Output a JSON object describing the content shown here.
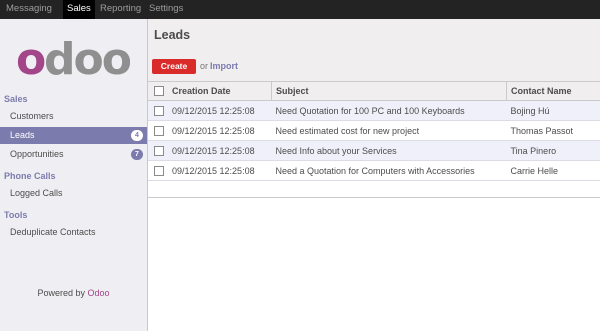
{
  "topnav": {
    "items": [
      {
        "label": "Messaging",
        "active": false
      },
      {
        "label": "Sales",
        "active": true
      },
      {
        "label": "Reporting",
        "active": false
      },
      {
        "label": "Settings",
        "active": false
      }
    ]
  },
  "brand": {
    "logo_text": "odoo",
    "logo_color": "#8f8f8f"
  },
  "sidebar": {
    "sections": [
      {
        "title": "Sales",
        "items": [
          {
            "label": "Customers",
            "badge": null,
            "active": false
          },
          {
            "label": "Leads",
            "badge": "4",
            "active": true
          },
          {
            "label": "Opportunities",
            "badge": "7",
            "active": false
          }
        ]
      },
      {
        "title": "Phone Calls",
        "items": [
          {
            "label": "Logged Calls",
            "badge": null,
            "active": false
          }
        ]
      },
      {
        "title": "Tools",
        "items": [
          {
            "label": "Deduplicate Contacts",
            "badge": null,
            "active": false
          }
        ]
      }
    ],
    "powered_prefix": "Powered by",
    "powered_brand": "Odoo"
  },
  "main": {
    "title": "Leads",
    "create_label": "Create",
    "or_text": "or",
    "import_label": "Import",
    "columns": [
      "Creation Date",
      "Subject",
      "Contact Name"
    ],
    "rows": [
      {
        "date": "09/12/2015 12:25:08",
        "subject": "Need Quotation for 100 PC and 100 Keyboards",
        "contact": "Bojing Hú"
      },
      {
        "date": "09/12/2015 12:25:08",
        "subject": "Need estimated cost for new project",
        "contact": "Thomas Passot"
      },
      {
        "date": "09/12/2015 12:25:08",
        "subject": "Need Info about your Services",
        "contact": "Tina Pinero"
      },
      {
        "date": "09/12/2015 12:25:08",
        "subject": "Need a Quotation for Computers with Accessories",
        "contact": "Carrie Helle"
      }
    ]
  },
  "colors": {
    "accent": "#7c7bad",
    "create_button": "#d82b2a",
    "topbar": "#232323",
    "brand_purple": "#a24689"
  }
}
